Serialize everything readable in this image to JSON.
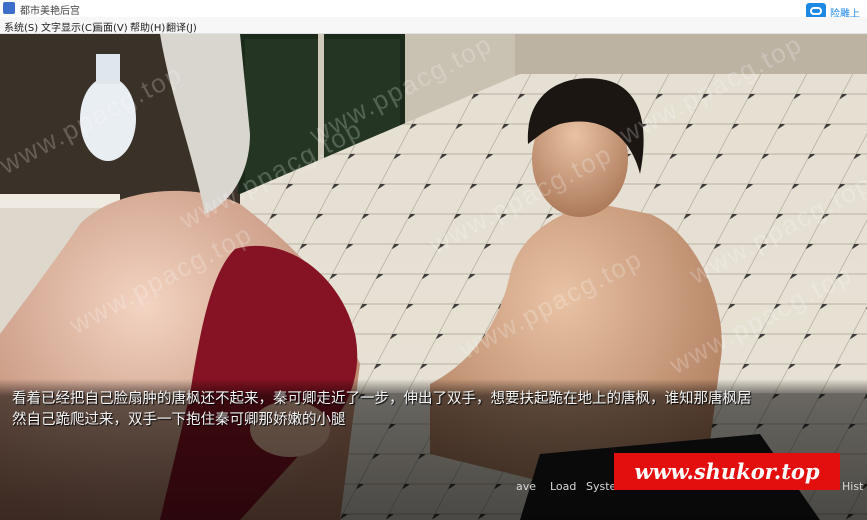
{
  "window": {
    "title": "都市美艳后宫"
  },
  "titlebar": {
    "upload_label": "险雕上伟"
  },
  "menu": [
    {
      "label": "系统(S)"
    },
    {
      "label": "文字显示(C)"
    },
    {
      "label": "画面(V)"
    },
    {
      "label": "帮助(H)"
    },
    {
      "label": "翻译(J)"
    }
  ],
  "watermark": {
    "text": "www.ppacg.top"
  },
  "dialogue": {
    "line1": "看着已经把自己脸扇肿的唐枫还不起来，秦可卿走近了一步，伸出了双手，想要扶起跪在地上的唐枫，谁知那唐枫居",
    "line2": "然自己跪爬过来，双手一下抱住秦可卿那娇嫩的小腿"
  },
  "quick_menu": [
    {
      "label": "ave"
    },
    {
      "label": "Load"
    },
    {
      "label": "Syste"
    },
    {
      "label": "Hist"
    }
  ],
  "banner": {
    "text": "www.shukor.top"
  },
  "colors": {
    "banner_bg": "#e30f0f",
    "menubar_bg": "#f7f7f7",
    "accent": "#1e88e5"
  }
}
